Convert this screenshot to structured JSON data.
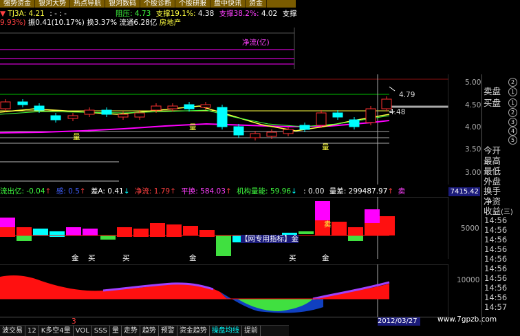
{
  "top_tabs": [
    "强势资金",
    "银河大势",
    "热点导航",
    "银河数码",
    "个股诊断",
    "个股研报",
    "盘中快讯",
    "资金"
  ],
  "info": {
    "code_price": "TJ3A: 4.21",
    "code_dashes": ": - : -",
    "resist_label": "阻压:",
    "resist_val": "4.73",
    "support1_label": "支撑19.1%:",
    "support1_val": "4.38",
    "support2_label": "支撑38.2%:",
    "support2_val": "4.02",
    "support3_label": "支撑",
    "line2_pct": "9.93%)",
    "line2_rest": "振0.41(10.17%) 换3.37% 流通6.28亿",
    "sector": "房地产",
    "net_flow_label": "净流(亿)"
  },
  "price_chart": {
    "price_label_high": "4.79",
    "price_label_low": "4.48",
    "axis_ticks": [
      "5.00",
      "4.50",
      "4.00",
      "3.50",
      "3.00"
    ],
    "markers": [
      "量",
      "量",
      "量"
    ]
  },
  "indicator_row": {
    "out_flow": "流出亿: -0.04",
    "item2": "感: 0.5",
    "diff_a": "差A: 0.41",
    "net_flow": "净流: 1.79",
    "avg_change": "平换: 584.03",
    "inst_energy": "机构量能: 59.96",
    "vol_zero": ": 0.00",
    "vol_diff": "量差: 299487.97",
    "sell": "卖",
    "box_value": "7415.42"
  },
  "volume_chart": {
    "axis_tick": "5000",
    "labels": [
      "金",
      "买",
      "买",
      "金",
      "买",
      "金"
    ],
    "center_label": "【网专用指标】金",
    "sell_label": "卖"
  },
  "macd_chart": {
    "axis_tick": "10000"
  },
  "right_panel": {
    "circles_top": [
      "2",
      "1",
      "1",
      "2"
    ],
    "sell_disk": "卖盘",
    "buy_disk": "买盘",
    "circles_mid": [
      "3",
      "4",
      "5"
    ],
    "items": [
      "今开",
      "最高",
      "最低",
      "外盘",
      "换手",
      "净资",
      "收益"
    ],
    "yield_extra": "(三)",
    "times": [
      "14:56",
      "14:56",
      "14:56",
      "14:56",
      "14:56",
      "14:56",
      "14:56",
      "14:56",
      "14:56",
      "14:57"
    ]
  },
  "status": {
    "left_num": "3",
    "date": "2012/03/27",
    "watermark": "www.7gpzb.com"
  },
  "bottom_tabs": [
    "波交易",
    "12",
    "K多空4量",
    "VOL",
    "SSS",
    "量",
    "走势",
    "趋势",
    "预警",
    "资金趋势",
    "操盘均线",
    "提前"
  ],
  "colors": {
    "up": "#ff3030",
    "down": "#00ffff",
    "magenta": "#ff00ff",
    "yellow": "#ffff00"
  }
}
